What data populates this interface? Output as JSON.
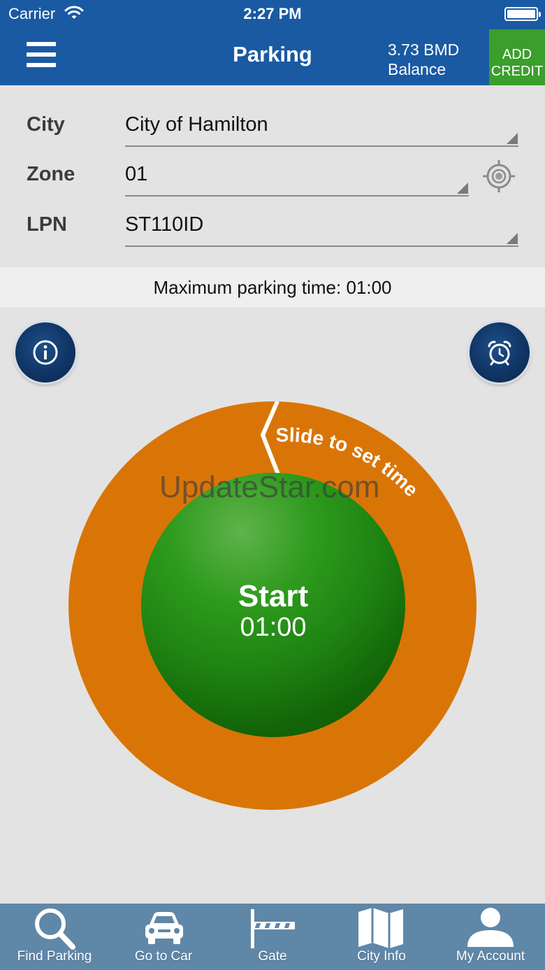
{
  "status_bar": {
    "carrier": "Carrier",
    "time": "2:27 PM"
  },
  "nav": {
    "title": "Parking",
    "balance_amount": "3.73 BMD",
    "balance_label": "Balance",
    "add_credit_line1": "ADD",
    "add_credit_line2": "CREDIT"
  },
  "form": {
    "city": {
      "label": "City",
      "value": "City of Hamilton"
    },
    "zone": {
      "label": "Zone",
      "value": "01"
    },
    "lpn": {
      "label": "LPN",
      "value": "ST110ID"
    }
  },
  "max_parking_text": "Maximum parking time: 01:00",
  "dial": {
    "slide_hint": "Slide to set time",
    "start_label": "Start",
    "start_time": "01:00"
  },
  "watermark": "UpdateStar.com",
  "tabs": [
    {
      "label": "Find Parking",
      "icon": "magnifier-icon"
    },
    {
      "label": "Go to Car",
      "icon": "car-icon"
    },
    {
      "label": "Gate",
      "icon": "gate-barrier-icon"
    },
    {
      "label": "City Info",
      "icon": "map-icon"
    },
    {
      "label": "My Account",
      "icon": "person-icon"
    }
  ],
  "colors": {
    "header_blue": "#1a5aa3",
    "add_credit_green": "#3a9f2c",
    "dial_orange": "#d97506",
    "start_green": "#1f8412",
    "tab_bar": "#5f87a8",
    "round_button_navy": "#103565"
  }
}
